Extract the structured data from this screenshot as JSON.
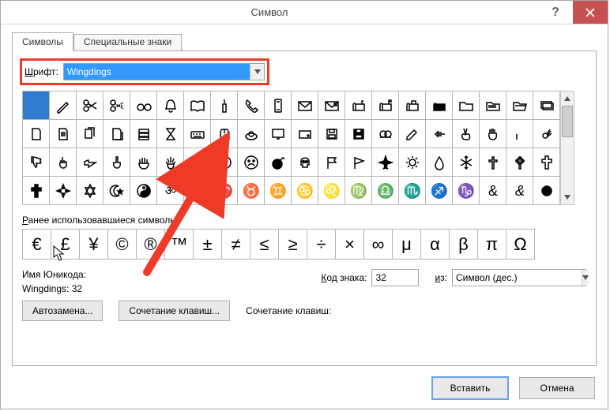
{
  "window": {
    "title": "Символ"
  },
  "tabs": {
    "symbols": "Символы",
    "special": "Специальные знаки"
  },
  "font": {
    "label_prefix": "Ш",
    "label_rest": "рифт:",
    "value": "Wingdings"
  },
  "symbol_grid": [
    [
      "blank",
      "pencil",
      "scissors",
      "scissors-cut",
      "glasses",
      "bell",
      "book-open",
      "candle",
      "phone",
      "phone-cell",
      "envelope",
      "envelope-stamp",
      "mailbox",
      "mailbox-flag",
      "mailbox-open",
      "mailbox-closed",
      "folder",
      "folder-files",
      "folder-open",
      "folder-stack"
    ],
    [
      "page",
      "page-lines",
      "pages",
      "page-shadow",
      "filing",
      "hourglass",
      "keyboard",
      "mouse",
      "trackball",
      "monitor",
      "harddisk",
      "floppy",
      "floppy-bold",
      "tape",
      "hand-write",
      "hand-left",
      "hand-victory",
      "hand-stop",
      "thumbs-up",
      "hand-ok"
    ],
    [
      "thumbs-down",
      "flip-off",
      "hand-point-right",
      "finger-up",
      "hand-open",
      "hand-spread",
      "smile",
      "neutral-face",
      "frown",
      "bomb",
      "skull",
      "flag",
      "pennant",
      "airplane",
      "sun",
      "raindrop",
      "snowflake",
      "cross",
      "cross-celtic",
      "cross-outline"
    ],
    [
      "cross-heavy",
      "cross-maltese",
      "star-david",
      "crescent-star",
      "yin-yang",
      "om",
      "wheel",
      "aries",
      "taurus",
      "gemini",
      "cancer",
      "leo",
      "virgo",
      "libra",
      "scorpio",
      "sagittarius",
      "capricorn",
      "ampersand",
      "ampersand-italic",
      "circle-solid"
    ]
  ],
  "recent": {
    "label_prefix": "Р",
    "label_rest": "анее использовавшиеся символы:",
    "items": [
      "€",
      "£",
      "¥",
      "©",
      "®",
      "™",
      "±",
      "≠",
      "≤",
      "≥",
      "÷",
      "×",
      "∞",
      "μ",
      "α",
      "β",
      "π",
      "Ω"
    ]
  },
  "unicode": {
    "name_label": "Имя Юникода:",
    "charset_line": "Wingdings: 32"
  },
  "code": {
    "label_prefix": "К",
    "label_rest": "од знака:",
    "value": "32",
    "from_label_prefix": "и",
    "from_label_rest": "з:",
    "from_value": "Символ (дес.)"
  },
  "buttons": {
    "autocorrect": "Автозамена...",
    "shortcut": "Сочетание клавиш...",
    "shortcut_label": "Сочетание клавиш:",
    "insert": "Вставить",
    "cancel": "Отмена"
  }
}
